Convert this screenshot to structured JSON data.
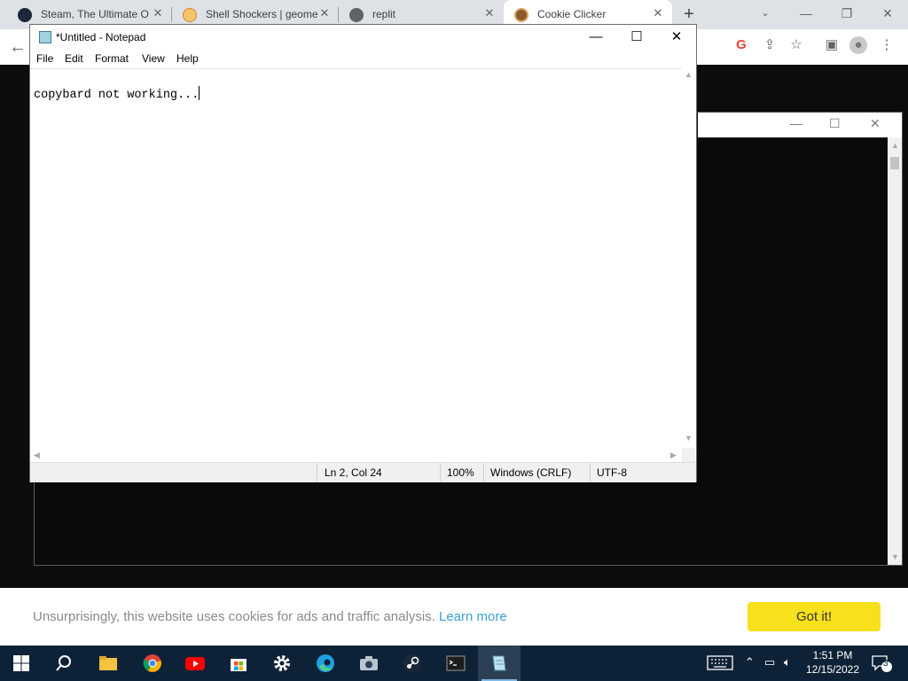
{
  "browser": {
    "tabs": [
      {
        "title": "Steam, The Ultimate O",
        "icon": "steam-icon",
        "active": false
      },
      {
        "title": "Shell Shockers | geome",
        "icon": "shellshockers-egg-icon",
        "active": false
      },
      {
        "title": "replit",
        "icon": "globe-icon",
        "active": false
      },
      {
        "title": "Cookie Clicker",
        "icon": "cookie-icon",
        "active": true
      }
    ],
    "new_tab_label": "+",
    "close_glyph": "✕"
  },
  "notepad": {
    "title": "*Untitled - Notepad",
    "menu": [
      "File",
      "Edit",
      "Format",
      "View",
      "Help"
    ],
    "content": "copybard not working...",
    "status": {
      "position": "Ln 2, Col 24",
      "zoom": "100%",
      "line_ending": "Windows (CRLF)",
      "encoding": "UTF-8"
    }
  },
  "cookie_banner": {
    "message": "Unsurprisingly, this website uses cookies for ads and traffic analysis.",
    "link": "Learn more",
    "button": "Got it!"
  },
  "taskbar": {
    "apps": [
      "start-icon",
      "search-icon",
      "file-explorer-icon",
      "chrome-icon",
      "youtube-icon",
      "microsoft-store-icon",
      "settings-gear-icon",
      "edge-icon",
      "camera-icon",
      "steam-icon",
      "terminal-icon",
      "notepad-icon"
    ],
    "time": "1:51 PM",
    "date": "12/15/2022",
    "notification_count": "3"
  },
  "colors": {
    "taskbar": "#0e2237",
    "cookie_button": "#f7e01c",
    "cookie_link": "#3aa0d8"
  }
}
